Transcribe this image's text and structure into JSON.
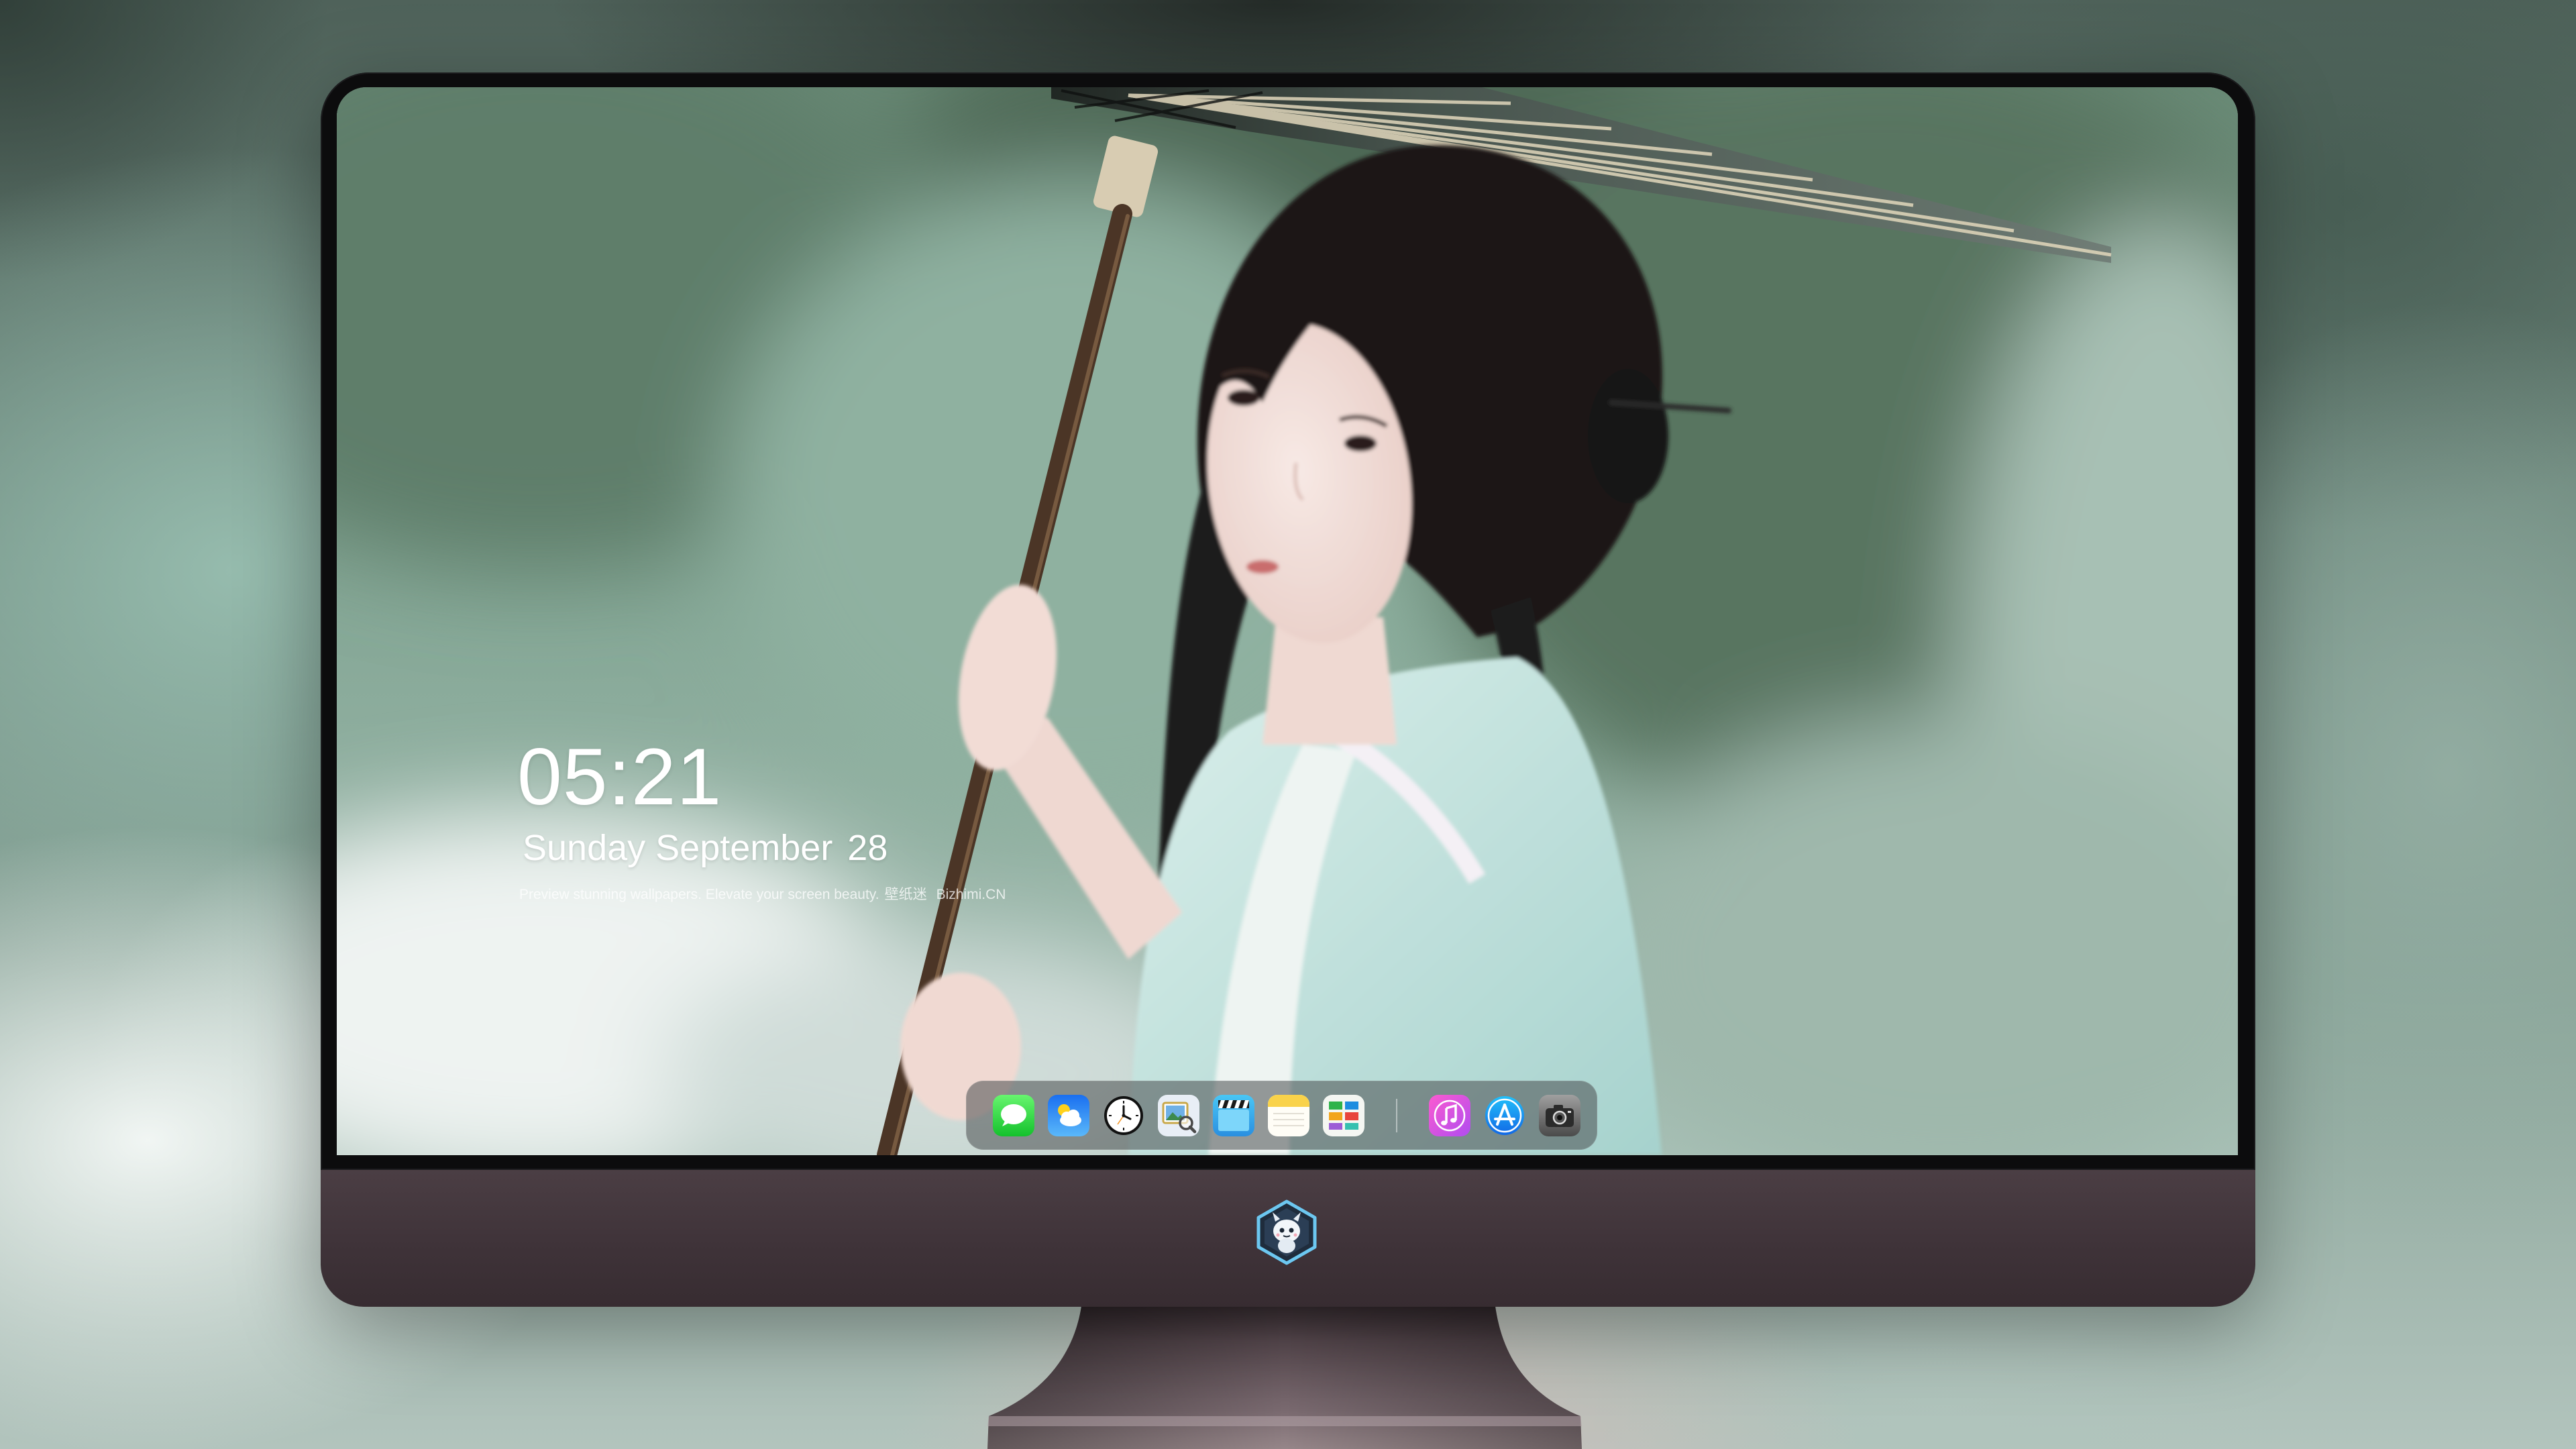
{
  "lockscreen": {
    "time": "05:21",
    "date_weekday_month": "Sunday September",
    "date_day": "28",
    "tagline": "Preview stunning wallpapers. Elevate your screen beauty.",
    "tagline_cn": "壁纸迷",
    "tagline_site": "Bizhimi.CN"
  },
  "dock": {
    "apps": [
      {
        "icon": "messages-icon"
      },
      {
        "icon": "weather-icon"
      },
      {
        "icon": "clock-icon"
      },
      {
        "icon": "preview-icon"
      },
      {
        "icon": "clips-icon"
      },
      {
        "icon": "notes-icon"
      },
      {
        "icon": "numbers-icon"
      },
      {
        "icon": "music-icon"
      },
      {
        "icon": "app-store-icon"
      },
      {
        "icon": "camera-icon"
      }
    ]
  },
  "chin": {
    "logo_icon": "mascot-badge-icon"
  },
  "colors": {
    "bezel": "#0c0c0d",
    "chin": "#3f3339",
    "stand": "#6a5a60",
    "dock_background": "rgba(72,76,78,0.55)",
    "lockscreen_text": "#ffffff",
    "wallpaper_green": "#7e9d8c"
  }
}
